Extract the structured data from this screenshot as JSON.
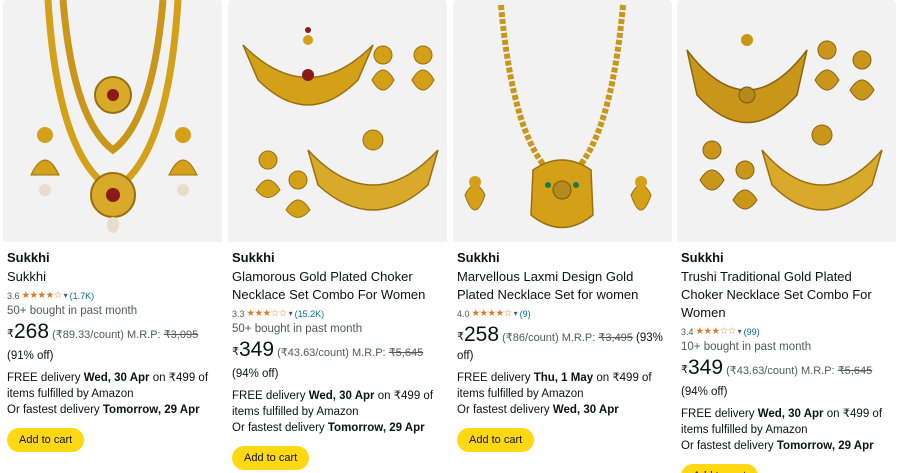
{
  "products": [
    {
      "brand": "Sukkhi",
      "title": "Sukkhi",
      "rating": "3.6",
      "rating_value": 3.6,
      "stars": "★★★★☆",
      "review_count": "(1.7K)",
      "bought": "50+ bought in past month",
      "currency": "₹",
      "price": "268",
      "unit_price": "(₹89.33/count)",
      "mrp_label": "M.R.P:",
      "mrp": "₹3,095",
      "discount": "(91% off)",
      "delivery_prefix": "FREE delivery",
      "delivery_date": "Wed, 30 Apr",
      "delivery_suffix": "on ₹499 of items fulfilled by Amazon",
      "fastest_prefix": "Or fastest delivery",
      "fastest_date": "Tomorrow, 29 Apr",
      "cart_label": "Add to cart"
    },
    {
      "brand": "Sukkhi",
      "title": "Glamorous Gold Plated Choker Necklace Set Combo For Women",
      "rating": "3.3",
      "rating_value": 3.3,
      "stars": "★★★☆☆",
      "review_count": "(15.2K)",
      "bought": "50+ bought in past month",
      "currency": "₹",
      "price": "349",
      "unit_price": "(₹43.63/count)",
      "mrp_label": "M.R.P:",
      "mrp": "₹5,645",
      "discount": "(94% off)",
      "delivery_prefix": "FREE delivery",
      "delivery_date": "Wed, 30 Apr",
      "delivery_suffix": "on ₹499 of items fulfilled by Amazon",
      "fastest_prefix": "Or fastest delivery",
      "fastest_date": "Tomorrow, 29 Apr",
      "cart_label": "Add to cart"
    },
    {
      "brand": "Sukkhi",
      "title": "Marvellous Laxmi Design Gold Plated Necklace Set for women",
      "rating": "4.0",
      "rating_value": 4.0,
      "stars": "★★★★☆",
      "review_count": "(9)",
      "bought": "",
      "currency": "₹",
      "price": "258",
      "unit_price": "(₹86/count)",
      "mrp_label": "M.R.P:",
      "mrp": "₹3,495",
      "discount": "(93% off)",
      "delivery_prefix": "FREE delivery",
      "delivery_date": "Thu, 1 May",
      "delivery_suffix": "on ₹499 of items fulfilled by Amazon",
      "fastest_prefix": "Or fastest delivery",
      "fastest_date": "Wed, 30 Apr",
      "cart_label": "Add to cart"
    },
    {
      "brand": "Sukkhi",
      "title": "Trushi Traditional Gold Plated Choker Necklace Set Combo For Women",
      "rating": "3.4",
      "rating_value": 3.4,
      "stars": "★★★☆☆",
      "review_count": "(99)",
      "bought": "10+ bought in past month",
      "currency": "₹",
      "price": "349",
      "unit_price": "(₹43.63/count)",
      "mrp_label": "M.R.P:",
      "mrp": "₹5,645",
      "discount": "(94% off)",
      "delivery_prefix": "FREE delivery",
      "delivery_date": "Wed, 30 Apr",
      "delivery_suffix": "on ₹499 of items fulfilled by Amazon",
      "fastest_prefix": "Or fastest delivery",
      "fastest_date": "Tomorrow, 29 Apr",
      "cart_label": "Add to cart"
    }
  ],
  "colors": {
    "gold": "#d4a017",
    "gold_dark": "#a87b10",
    "star": "#de7921",
    "link": "#007185",
    "button": "#ffd814"
  }
}
